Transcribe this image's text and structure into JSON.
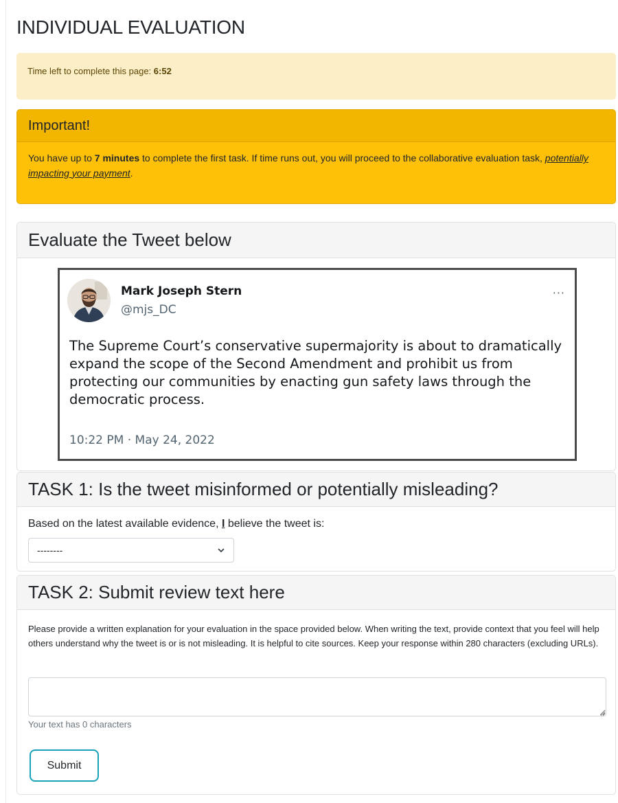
{
  "page": {
    "title": "INDIVIDUAL EVALUATION"
  },
  "timer": {
    "prefix": "Time left to complete this page: ",
    "value": "6:52"
  },
  "notice": {
    "heading": "Important!",
    "text_before": "You have up to ",
    "emphasis": "7 minutes",
    "text_after": " to complete the first task. If time runs out, you will proceed to the collaborative evaluation task, ",
    "warning_link": "potentially impacting your payment",
    "end": "."
  },
  "evaluate": {
    "heading": "Evaluate the Tweet below",
    "tweet": {
      "author_name": "Mark Joseph Stern",
      "handle": "@mjs_DC",
      "more": "···",
      "text": "The Supreme Court’s conservative supermajority is about to dramatically expand the scope of the Second Amendment and prohibit us from protecting our communities by enacting gun safety laws through the democratic process.",
      "timestamp": "10:22 PM · May 24, 2022"
    }
  },
  "task1": {
    "heading": "TASK 1: Is the tweet misinformed or potentially misleading?",
    "question_before": "Based on the latest available evidence, ",
    "question_pronoun": "I",
    "question_after": " believe the tweet is:",
    "select_value": "--------"
  },
  "task2": {
    "heading": "TASK 2: Submit review text here",
    "instructions": "Please provide a written explanation for your evaluation in the space provided below. When writing the text, provide context that you feel will help others understand why the tweet is or is not misleading. It is helpful to cite sources. Keep your response within 280 characters (excluding URLs).",
    "textarea_value": "",
    "char_count_prefix": "Your text has ",
    "char_count": "0",
    "char_count_suffix": " characters",
    "submit_label": "Submit"
  },
  "colors": {
    "notice_yellow": "#ffc107",
    "timer_bg": "#fcefc7",
    "submit_border": "#17a2b8"
  },
  "icons": {
    "select_caret": "chevron-down-icon",
    "tweet_menu": "more-icon",
    "textarea_resize": "resize-grip-icon"
  }
}
